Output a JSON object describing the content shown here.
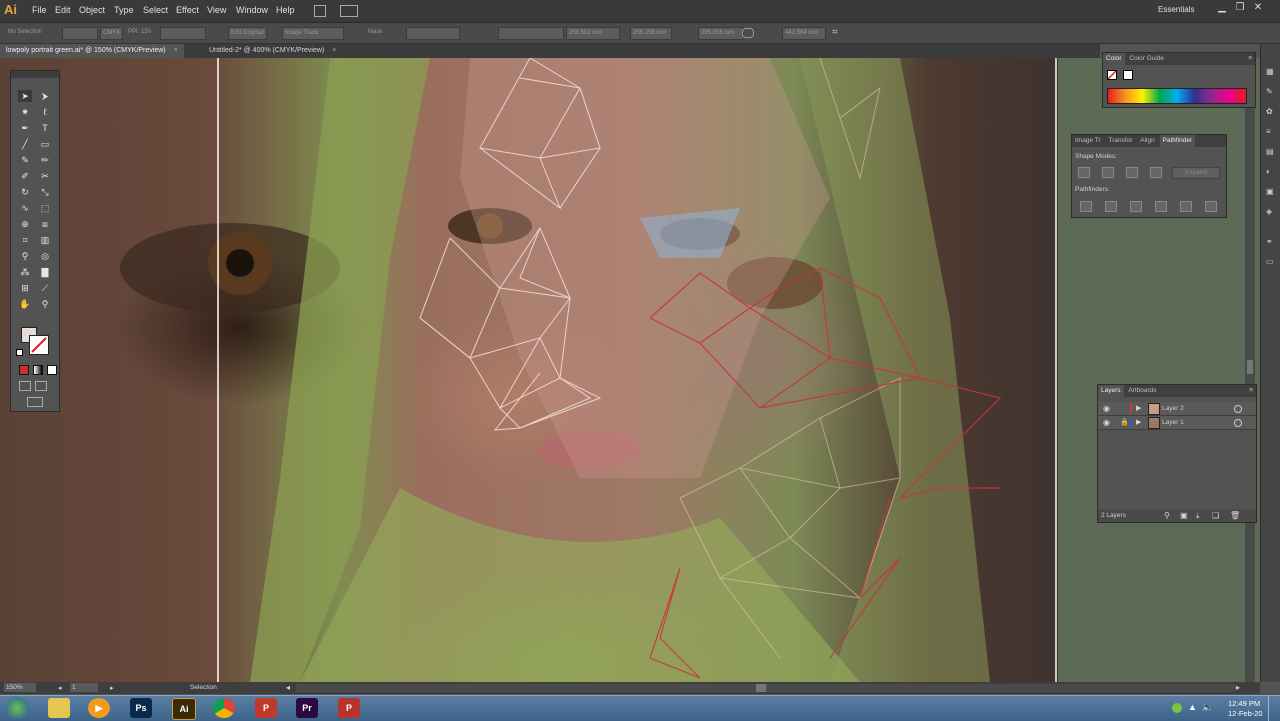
{
  "app": {
    "logo": "Ai",
    "workspace": "Essentials"
  },
  "menu": [
    "File",
    "Edit",
    "Object",
    "Type",
    "Select",
    "Effect",
    "View",
    "Window",
    "Help"
  ],
  "window_controls": {
    "minimize": "▁",
    "restore": "❐",
    "close": "✕"
  },
  "controlbar": {
    "selection_label": "No Selection",
    "color_mode": "CMYK",
    "ppi": "PPI: 150",
    "edit_original": "Edit Original",
    "image_trace": "Image Trace",
    "mask": "Mask",
    "x_value": "258.502 mm",
    "y_value": "258.256 mm",
    "w_value": "295.056 mm",
    "h_value": "442.584 mm"
  },
  "tabs": [
    {
      "label": "lowpoly portrait green.ai* @ 150% (CMYK/Preview)",
      "close": "×"
    },
    {
      "label": "Untitled-2* @ 400% (CMYK/Preview)",
      "close": "×"
    }
  ],
  "color_panel": {
    "tabs": [
      "Color",
      "Color Guide"
    ]
  },
  "pathfinder_panel": {
    "tabs": [
      "Image Tr",
      "Transfor",
      "Align",
      "Pathfinder"
    ],
    "shape_modes_label": "Shape Modes:",
    "expand_label": "Expand",
    "pathfinders_label": "Pathfinders:"
  },
  "layers_panel": {
    "tabs": [
      "Layers",
      "Artboards"
    ],
    "layers": [
      {
        "name": "Layer 2",
        "color": "#e03030"
      },
      {
        "name": "Layer 1",
        "color": "#2f5fd6"
      }
    ],
    "count_label": "2 Layers"
  },
  "statusbar": {
    "zoom": "150%",
    "artboard": "1",
    "tool": "Selection"
  },
  "taskbar": {
    "apps": [
      {
        "name": "Ps",
        "color": "#0b2a4a"
      },
      {
        "name": "Ai",
        "color": "#3a2a08"
      },
      {
        "name": "Pr",
        "color": "#2a0a40"
      },
      {
        "name": "P",
        "color": "#b8332a"
      }
    ],
    "time": "12:49 PM",
    "date": "12-Feb-20"
  }
}
